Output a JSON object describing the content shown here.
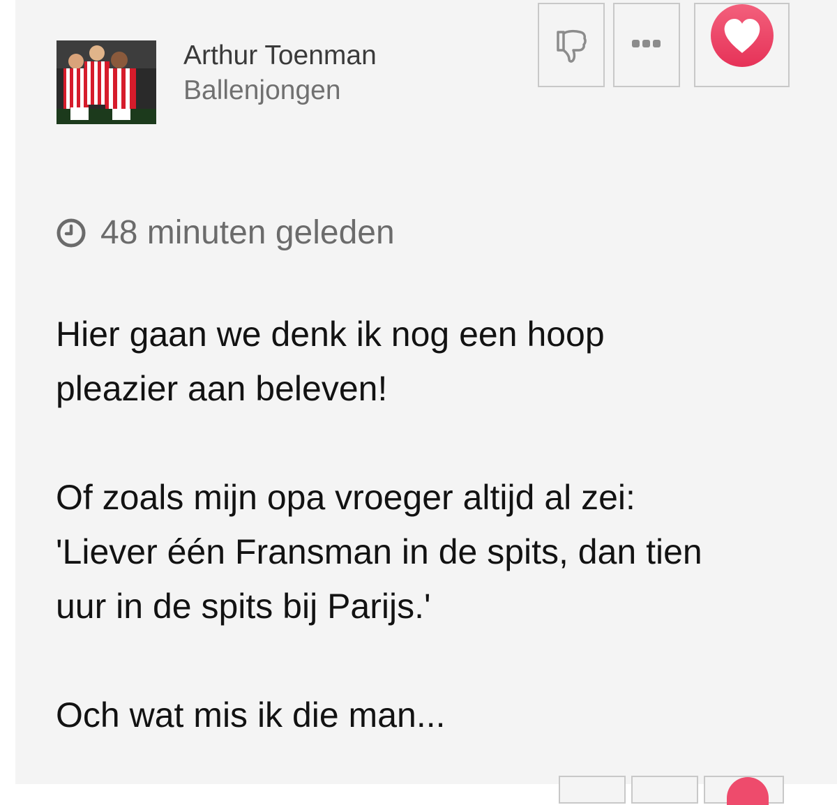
{
  "comment": {
    "author": {
      "name": "Arthur Toenman",
      "role": "Ballenjongen",
      "avatar_icon": "team-photo-avatar"
    },
    "actions": {
      "dislike_icon": "thumbs-down-icon",
      "more_icon": "more-dots-icon",
      "like_icon": "heart-icon",
      "like_color": "#ee4b6c"
    },
    "timestamp": {
      "icon": "clock-icon",
      "text": "48 minuten geleden"
    },
    "body": {
      "p1_l1": "Hier gaan we denk ik nog een hoop",
      "p1_l2": "pleazier aan beleven!",
      "p2_l1": "Of zoals mijn opa vroeger altijd al zei:",
      "p2_l2": "'Liever één Fransman in de spits, dan tien",
      "p2_l3": "uur in de spits bij Parijs.'",
      "p3_l1": "Och wat mis ik die man..."
    }
  },
  "colors": {
    "card_background": "#f4f4f4",
    "accent_heart": "#ee4b6c",
    "text_primary": "#121212",
    "text_secondary": "#6b6b6b"
  }
}
